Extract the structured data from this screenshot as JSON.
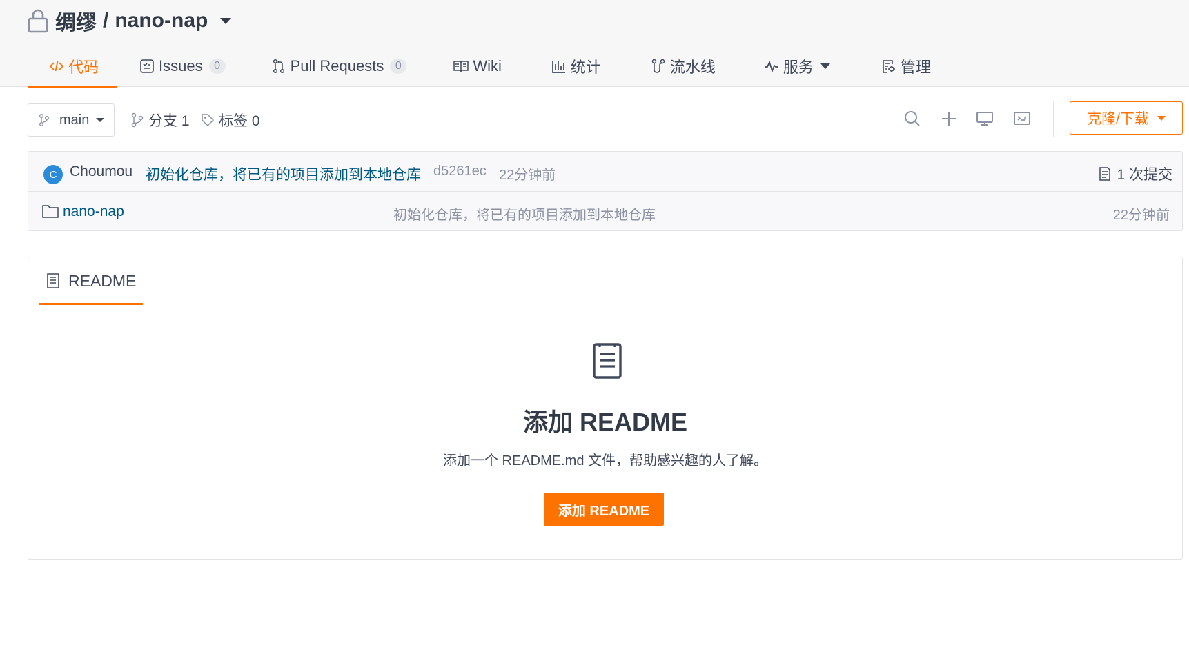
{
  "repo": {
    "owner": "绸缪",
    "separator": "/",
    "name": "nano-nap",
    "visibility_icon": "lock-icon"
  },
  "tabs": [
    {
      "label": "代码",
      "icon": "code-icon",
      "active": true
    },
    {
      "label": "Issues",
      "icon": "issues-icon",
      "count": "0"
    },
    {
      "label": "Pull Requests",
      "icon": "pull-request-icon",
      "count": "0"
    },
    {
      "label": "Wiki",
      "icon": "book-icon"
    },
    {
      "label": "统计",
      "icon": "bar-chart-icon"
    },
    {
      "label": "流水线",
      "icon": "pipeline-icon"
    },
    {
      "label": "服务",
      "icon": "pulse-icon",
      "dropdown": true
    },
    {
      "label": "管理",
      "icon": "settings-doc-icon"
    }
  ],
  "toolbar": {
    "branch": "main",
    "branches_label": "分支 1",
    "tags_label": "标签 0",
    "clone_label": "克隆/下载"
  },
  "latest_commit": {
    "avatar_letter": "C",
    "author": "Choumou",
    "message": "初始化仓库，将已有的项目添加到本地仓库",
    "hash": "d5261ec",
    "time": "22分钟前",
    "count_label": "1 次提交"
  },
  "files": [
    {
      "name": "nano-nap",
      "type": "folder",
      "commit": "初始化仓库，将已有的项目添加到本地仓库",
      "time": "22分钟前"
    }
  ],
  "readme": {
    "tab_label": "README",
    "empty_title": "添加 README",
    "empty_desc": "添加一个 README.md 文件，帮助感兴趣的人了解。",
    "add_button": "添加 README"
  },
  "colors": {
    "accent": "#fe7300",
    "link": "#005980",
    "muted": "#8c92a4",
    "text": "#40485b"
  }
}
